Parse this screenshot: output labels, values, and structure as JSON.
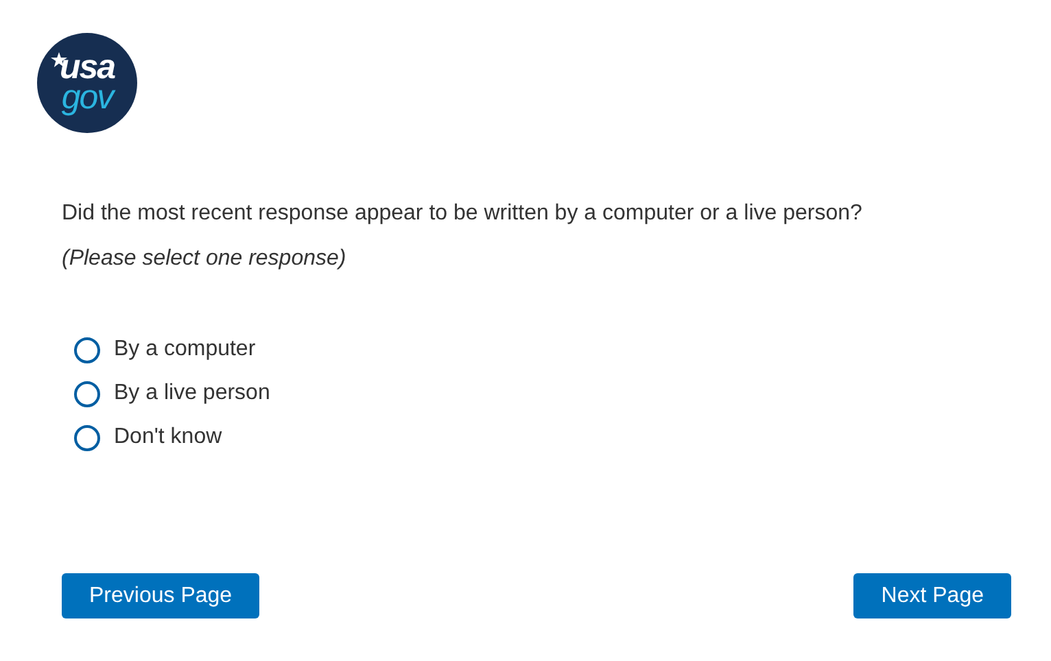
{
  "logo": {
    "line_1": "usa",
    "line_2": "gov"
  },
  "question": {
    "text": "Did the most recent response appear to be written by a computer or a live person?",
    "hint": "(Please select one response)"
  },
  "options": [
    {
      "label": "By a computer",
      "selected": false
    },
    {
      "label": "By a live person",
      "selected": false
    },
    {
      "label": "Don't know",
      "selected": false
    }
  ],
  "buttons": [
    {
      "label": "Previous Page"
    },
    {
      "label": "Next Page"
    }
  ]
}
